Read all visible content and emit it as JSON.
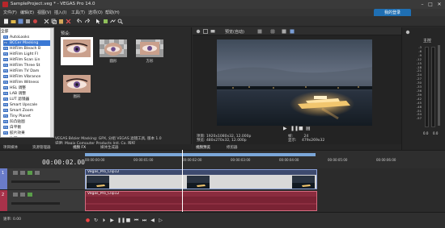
{
  "window": {
    "title": "SampleProject.veg * - VEGAS Pro 14.0",
    "minimize": "–",
    "maximize": "□",
    "close": "✕"
  },
  "menu": [
    "文件(F)",
    "编辑(E)",
    "视图(V)",
    "插入(I)",
    "工具(T)",
    "选项(O)",
    "帮助(H)"
  ],
  "login": {
    "label": "我的登录"
  },
  "toolbar_icons": [
    "new-file-icon",
    "open-folder-icon",
    "save-icon",
    "properties-icon",
    "render-icon",
    "cut-icon",
    "copy-icon",
    "paste-icon",
    "delete-icon",
    "undo-icon",
    "redo-icon",
    "cursor-icon",
    "normal-edit-icon",
    "envelope-icon",
    "zoom-icon"
  ],
  "fx_tree": {
    "items": [
      {
        "label": "全部",
        "icon": "",
        "selected": false
      },
      {
        "label": "AutoLooks",
        "icon": "FX",
        "selected": false
      },
      {
        "label": "BCCer Masking",
        "icon": "FX",
        "selected": true
      },
      {
        "label": "HitFilm Bleach B",
        "icon": "FX",
        "selected": false
      },
      {
        "label": "HitFilm Light Fl",
        "icon": "FX",
        "selected": false
      },
      {
        "label": "HitFilm Scan Lin",
        "icon": "FX",
        "selected": false
      },
      {
        "label": "HitFilm Three St",
        "icon": "FX",
        "selected": false
      },
      {
        "label": "HitFilm TV Dam",
        "icon": "FX",
        "selected": false
      },
      {
        "label": "HitFilm Vibrance",
        "icon": "FX",
        "selected": false
      },
      {
        "label": "HitFilm Witness",
        "icon": "FX",
        "selected": false
      },
      {
        "label": "HSL 调整",
        "icon": "FX",
        "selected": false
      },
      {
        "label": "LAB 调整",
        "icon": "FX",
        "selected": false
      },
      {
        "label": "LUT 滤镜器",
        "icon": "FX",
        "selected": false
      },
      {
        "label": "Smart Upscale",
        "icon": "FX",
        "selected": false
      },
      {
        "label": "Smart Zoom",
        "icon": "FX",
        "selected": false
      },
      {
        "label": "Tiny Planet",
        "icon": "FX",
        "selected": false
      },
      {
        "label": "凹凸贴图",
        "icon": "FX",
        "selected": false
      },
      {
        "label": "白平衡",
        "icon": "FX",
        "selected": false
      },
      {
        "label": "胶片效果",
        "icon": "FX",
        "selected": false
      },
      {
        "label": "边框",
        "icon": "FX",
        "selected": false
      }
    ]
  },
  "presets": {
    "label": "预设:",
    "items": [
      {
        "caption": "",
        "selected": true
      },
      {
        "caption": "圆形",
        "selected": false
      },
      {
        "caption": "方形",
        "selected": false
      },
      {
        "caption": "图形",
        "selected": false
      }
    ]
  },
  "description": {
    "line1": "VEGAS Bézier Masking: GPX, 分组 VEGAS 滤镜工具, 版本 1.0",
    "line2": "说明: Magix Computer Products Intl. Co. 版权"
  },
  "left_tabs": [
    "项目媒体",
    "资源管理器",
    "视频 FX",
    "媒体生成器"
  ],
  "preview": {
    "toolbar_label": "预览(自动)",
    "tabs": [
      "视频预览",
      "修剪器"
    ],
    "info": {
      "project": "项目: 1920x1080x32, 12.000p",
      "preview": "预览: 480x270x32, 12.000p",
      "frame_label": "帧:",
      "frame_value": "24",
      "display_label": "显示:",
      "display_value": "479x269x32"
    }
  },
  "meter": {
    "title": "主控",
    "scale": [
      "-3",
      "-6",
      "-9",
      "-12",
      "-15",
      "-18",
      "-21",
      "-24",
      "-27",
      "-30",
      "-33",
      "-36",
      "-39",
      "-42",
      "-45",
      "-48",
      "-51",
      "-54",
      "-57"
    ],
    "values": [
      "0.0",
      "0.0"
    ]
  },
  "timeline": {
    "timecode": "00:00:02.00",
    "ruler": [
      "00:00:00:00",
      "00:00:01:00",
      "00:00:02:00",
      "00:00:03:00",
      "00:00:04:00",
      "00:00:05:00",
      "00:00:06:00"
    ],
    "tracks": [
      {
        "number": "1",
        "type": "video",
        "clip_name": "Vegas_Pro_Clip12",
        "color": "#6a7cc9"
      },
      {
        "number": "2",
        "type": "audio",
        "clip_name": "Vegas_Pro_Clip12",
        "color": "#a8324a"
      }
    ]
  },
  "bottom": {
    "rate_label": "速率: 0.00",
    "controls": [
      "record-icon",
      "loop-icon",
      "play-start-icon",
      "play-icon",
      "pause-icon",
      "stop-icon",
      "prev-frame-icon",
      "next-frame-icon",
      "go-start-icon",
      "go-end-icon"
    ]
  }
}
